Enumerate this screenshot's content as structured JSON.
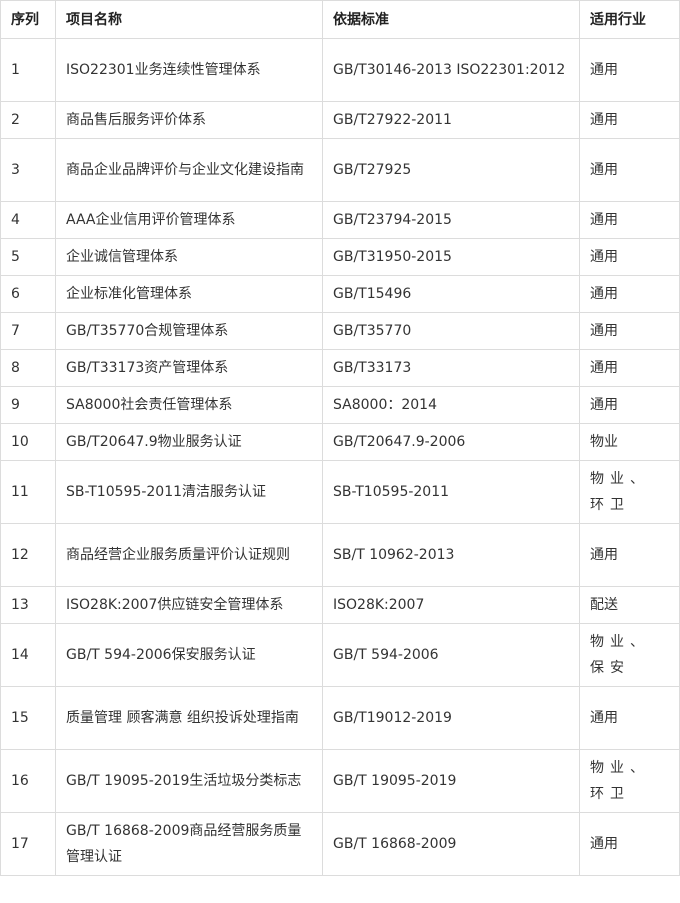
{
  "table": {
    "headers": {
      "no": "序列",
      "name": "项目名称",
      "standard": "依据标准",
      "industry": "适用行业"
    },
    "rows": [
      {
        "no": "1",
        "name": "ISO22301业务连续性管理体系",
        "standard": "GB/T30146-2013  ISO22301:2012",
        "industry": "通用",
        "tall": true
      },
      {
        "no": "2",
        "name": "商品售后服务评价体系",
        "standard": "GB/T27922-2011",
        "industry": "通用"
      },
      {
        "no": "3",
        "name": "商品企业品牌评价与企业文化建设指南",
        "standard": "GB/T27925",
        "industry": "通用",
        "tall": true
      },
      {
        "no": "4",
        "name": "AAA企业信用评价管理体系",
        "standard": "GB/T23794-2015",
        "industry": "通用"
      },
      {
        "no": "5",
        "name": "企业诚信管理体系",
        "standard": "GB/T31950-2015",
        "industry": "通用"
      },
      {
        "no": "6",
        "name": "企业标准化管理体系",
        "standard": "GB/T15496",
        "industry": "通用"
      },
      {
        "no": "7",
        "name": "GB/T35770合规管理体系",
        "standard": "GB/T35770",
        "industry": "通用"
      },
      {
        "no": "8",
        "name": "GB/T33173资产管理体系",
        "standard": "GB/T33173",
        "industry": "通用"
      },
      {
        "no": "9",
        "name": "SA8000社会责任管理体系",
        "standard": "SA8000：2014",
        "industry": "通用"
      },
      {
        "no": "10",
        "name": "GB/T20647.9物业服务认证",
        "standard": "GB/T20647.9-2006",
        "industry": "物业"
      },
      {
        "no": "11",
        "name": "SB-T10595-2011清洁服务认证",
        "standard": "SB-T10595-2011",
        "industry": "物业、环卫",
        "tall": true,
        "spread": true
      },
      {
        "no": "12",
        "name": "商品经营企业服务质量评价认证规则",
        "standard": "SB/T 10962-2013",
        "industry": "通用",
        "tall": true
      },
      {
        "no": "13",
        "name": "ISO28K:2007供应链安全管理体系",
        "standard": "ISO28K:2007",
        "industry": "配送"
      },
      {
        "no": "14",
        "name": "GB/T 594-2006保安服务认证",
        "standard": "GB/T 594-2006",
        "industry": "物业、保安",
        "tall": true,
        "spread": true
      },
      {
        "no": "15",
        "name": "质量管理 顾客满意 组织投诉处理指南",
        "standard": "GB/T19012-2019",
        "industry": "通用",
        "tall": true
      },
      {
        "no": "16",
        "name": "GB/T 19095-2019生活垃圾分类标志",
        "standard": "GB/T 19095-2019",
        "industry": "物业、环卫",
        "tall": true,
        "spread": true
      },
      {
        "no": "17",
        "name": "GB/T 16868-2009商品经营服务质量管理认证",
        "standard": "GB/T 16868-2009",
        "industry": "通用",
        "tall": true
      }
    ]
  }
}
